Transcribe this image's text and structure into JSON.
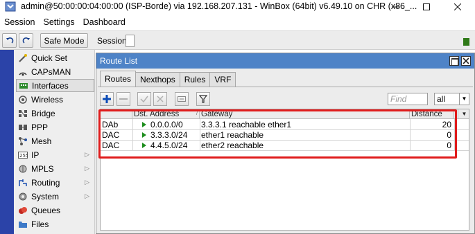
{
  "window": {
    "title": "admin@50:00:00:04:00:00 (ISP-Borde) via 192.168.207.131 - WinBox (64bit) v6.49.10 on CHR (x86_..."
  },
  "menubar": [
    "Session",
    "Settings",
    "Dashboard"
  ],
  "toolbar": {
    "safe_mode_label": "Safe Mode",
    "session_label": "Session:"
  },
  "sidebar": {
    "items": [
      {
        "label": "Quick Set",
        "icon": "wand-icon",
        "submenu": false
      },
      {
        "label": "CAPsMAN",
        "icon": "capsman-icon",
        "submenu": false
      },
      {
        "label": "Interfaces",
        "icon": "interfaces-icon",
        "submenu": false,
        "active": true
      },
      {
        "label": "Wireless",
        "icon": "wireless-icon",
        "submenu": false
      },
      {
        "label": "Bridge",
        "icon": "bridge-icon",
        "submenu": false
      },
      {
        "label": "PPP",
        "icon": "ppp-icon",
        "submenu": false
      },
      {
        "label": "Mesh",
        "icon": "mesh-icon",
        "submenu": false
      },
      {
        "label": "IP",
        "icon": "ip-icon",
        "submenu": true
      },
      {
        "label": "MPLS",
        "icon": "mpls-icon",
        "submenu": true
      },
      {
        "label": "Routing",
        "icon": "routing-icon",
        "submenu": true
      },
      {
        "label": "System",
        "icon": "system-icon",
        "submenu": true
      },
      {
        "label": "Queues",
        "icon": "queues-icon",
        "submenu": false
      },
      {
        "label": "Files",
        "icon": "files-icon",
        "submenu": false
      }
    ]
  },
  "route_list": {
    "title": "Route List",
    "tabs": [
      "Routes",
      "Nexthops",
      "Rules",
      "VRF"
    ],
    "active_tab": "Routes",
    "find_placeholder": "Find",
    "filter_value": "all",
    "columns": {
      "flags": "",
      "dst_address": "Dst. Address",
      "gateway": "Gateway",
      "distance": "Distance"
    },
    "rows": [
      {
        "flags": "DAb",
        "dst_address": "0.0.0.0/0",
        "gateway": "3.3.3.1 reachable ether1",
        "distance": "20"
      },
      {
        "flags": "DAC",
        "dst_address": "3.3.3.0/24",
        "gateway": "ether1 reachable",
        "distance": "0"
      },
      {
        "flags": "DAC",
        "dst_address": "4.4.5.0/24",
        "gateway": "ether2 reachable",
        "distance": "0"
      }
    ]
  },
  "colors": {
    "window_title_bar": "#4e83c7",
    "sidebar_band": "#2b43a8",
    "highlight_box": "#e01b1b",
    "route_active_triangle": "#1d8d1d"
  }
}
